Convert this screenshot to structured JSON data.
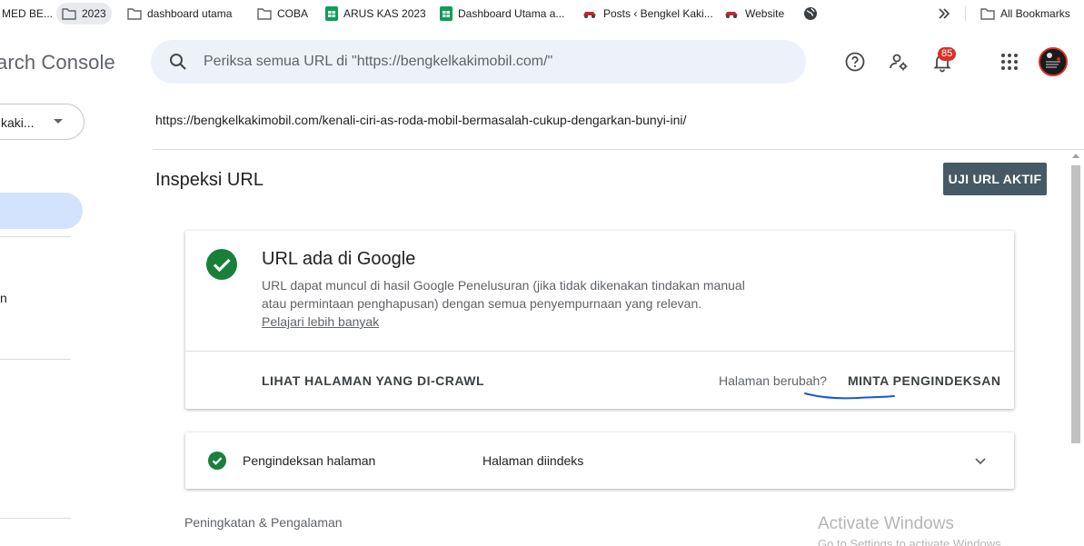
{
  "bookmarks": {
    "items": [
      {
        "label": "MED BE..."
      },
      {
        "label": "2023"
      },
      {
        "label": "dashboard utama"
      },
      {
        "label": "COBA"
      },
      {
        "label": "ARUS KAS 2023"
      },
      {
        "label": "Dashboard Utama a..."
      },
      {
        "label": "Posts ‹ Bengkel Kaki..."
      },
      {
        "label": "Website"
      }
    ],
    "overflow_icon": "double-chevron-right",
    "all_bookmarks": "All Bookmarks"
  },
  "header": {
    "app_title": "arch Console",
    "search_placeholder": "Periksa semua URL di \"https://bengkelkakimobil.com/\"",
    "notification_count": "85"
  },
  "sidebar": {
    "property": "kaki...",
    "partial_item": "n"
  },
  "inspection": {
    "url": "https://bengkelkakimobil.com/kenali-ciri-as-roda-mobil-bermasalah-cukup-dengarkan-bunyi-ini/",
    "page_title": "Inspeksi URL",
    "test_live_button": "UJI URL AKTIF"
  },
  "status_card": {
    "title": "URL ada di Google",
    "description_line1": "URL dapat muncul di hasil Google Penelusuran (jika tidak dikenakan tindakan manual",
    "description_line2": "atau permintaan penghapusan) dengan semua penyempurnaan yang relevan.",
    "learn_more": "Pelajari lebih banyak",
    "view_crawled": "LIHAT HALAMAN YANG DI-CRAWL",
    "page_changed": "Halaman berubah?",
    "request_indexing": "MINTA PENGINDEKSAN"
  },
  "indexing_card": {
    "label": "Pengindeksan halaman",
    "value": "Halaman diindeks"
  },
  "enhancements_heading": "Peningkatan & Pengalaman",
  "watermark": {
    "title": "Activate Windows",
    "subtitle": "Go to Settings to activate Windows."
  },
  "colors": {
    "success_green": "#188038",
    "accent_blue": "#1a56db",
    "primary_button": "#455a64",
    "badge_red": "#d93025",
    "search_bg": "#edf2fa"
  }
}
